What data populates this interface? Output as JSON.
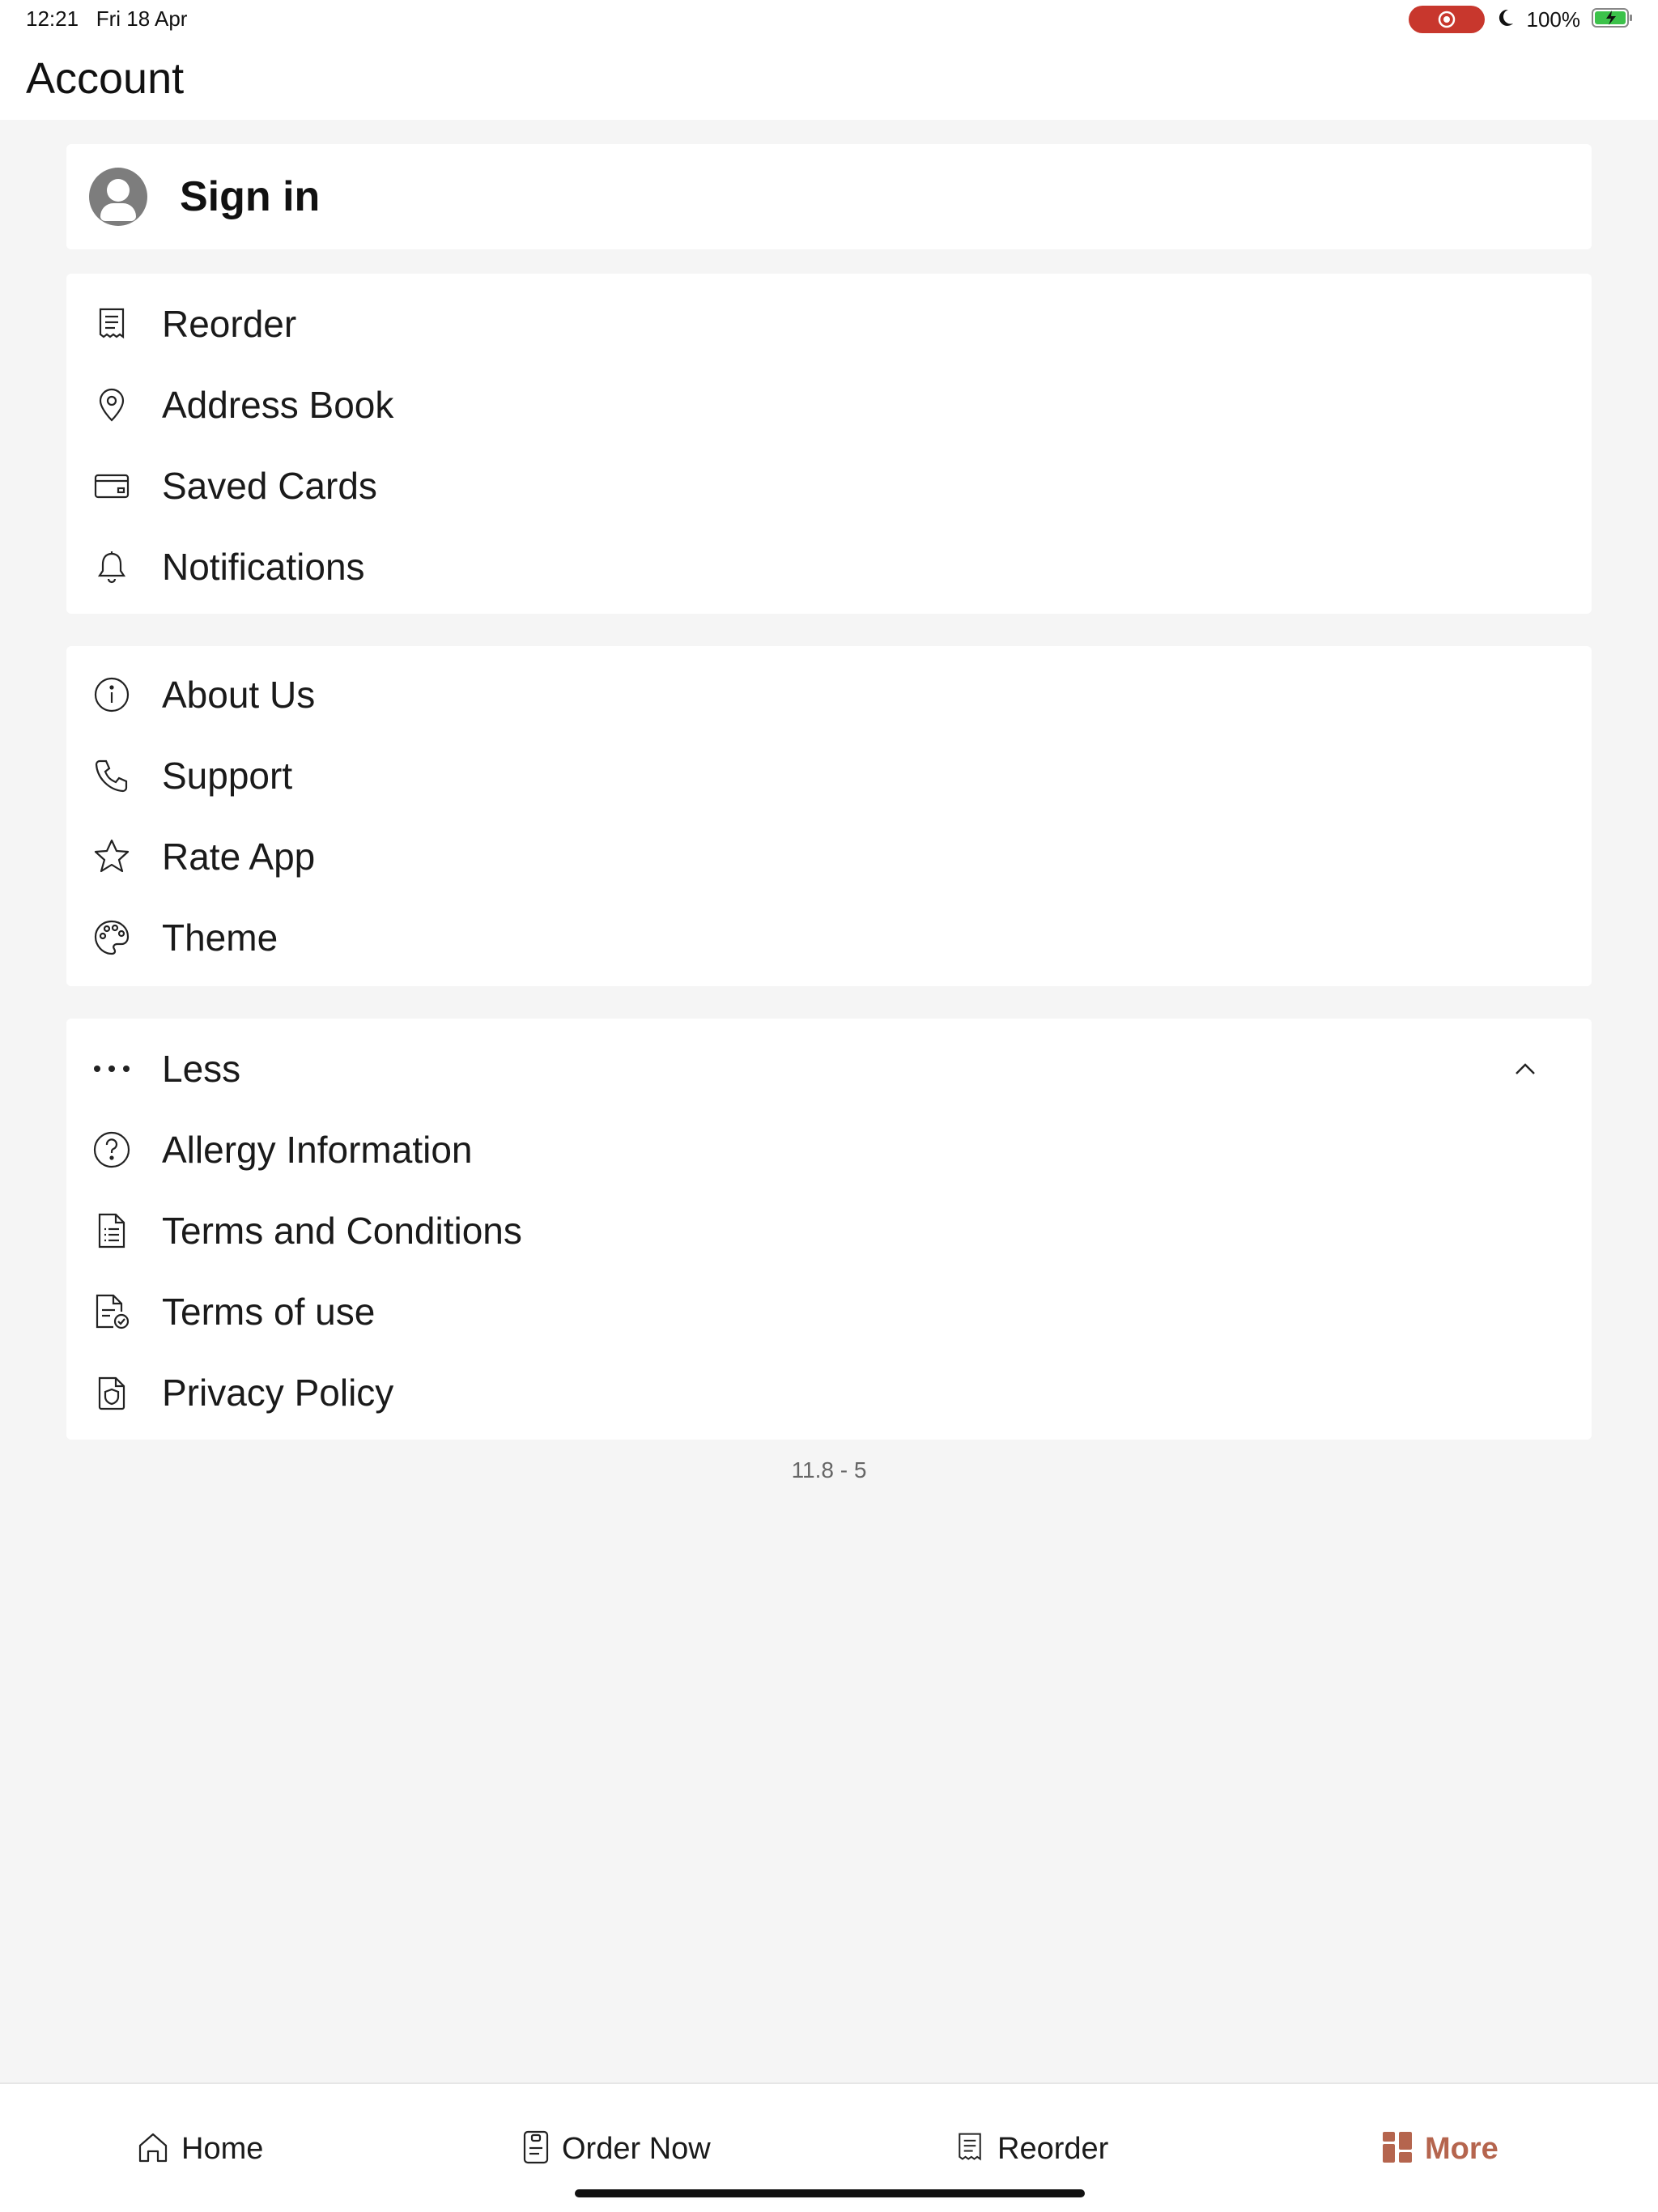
{
  "status_bar": {
    "time": "12:21",
    "date": "Fri 18 Apr",
    "battery": "100%",
    "recording_color": "#c8372d",
    "icons": [
      "record-icon",
      "moon-icon",
      "battery-charging-icon"
    ]
  },
  "header": {
    "title": "Account"
  },
  "sign_in": {
    "label": "Sign in",
    "icon": "user-avatar-icon"
  },
  "account_menu": [
    {
      "label": "Reorder",
      "icon": "receipt-icon"
    },
    {
      "label": "Address Book",
      "icon": "location-pin-icon"
    },
    {
      "label": "Saved Cards",
      "icon": "credit-card-icon"
    },
    {
      "label": "Notifications",
      "icon": "bell-icon"
    }
  ],
  "info_menu": [
    {
      "label": "About Us",
      "icon": "info-icon"
    },
    {
      "label": "Support",
      "icon": "phone-icon"
    },
    {
      "label": "Rate App",
      "icon": "star-icon"
    },
    {
      "label": "Theme",
      "icon": "palette-icon"
    }
  ],
  "legal_menu": {
    "toggle_label": "Less",
    "toggle_icon": "more-dots-icon",
    "expanded": true,
    "items": [
      {
        "label": "Allergy Information",
        "icon": "question-circle-icon"
      },
      {
        "label": "Terms and Conditions",
        "icon": "document-list-icon"
      },
      {
        "label": "Terms of use",
        "icon": "document-check-icon"
      },
      {
        "label": "Privacy Policy",
        "icon": "shield-document-icon"
      }
    ]
  },
  "version": "11.8 - 5",
  "tab_bar": {
    "accent_color": "#b5654e",
    "tabs": [
      {
        "label": "Home",
        "icon": "home-icon",
        "active": false
      },
      {
        "label": "Order Now",
        "icon": "menu-card-icon",
        "active": false
      },
      {
        "label": "Reorder",
        "icon": "receipt-icon",
        "active": false
      },
      {
        "label": "More",
        "icon": "grid-icon",
        "active": true
      }
    ]
  }
}
